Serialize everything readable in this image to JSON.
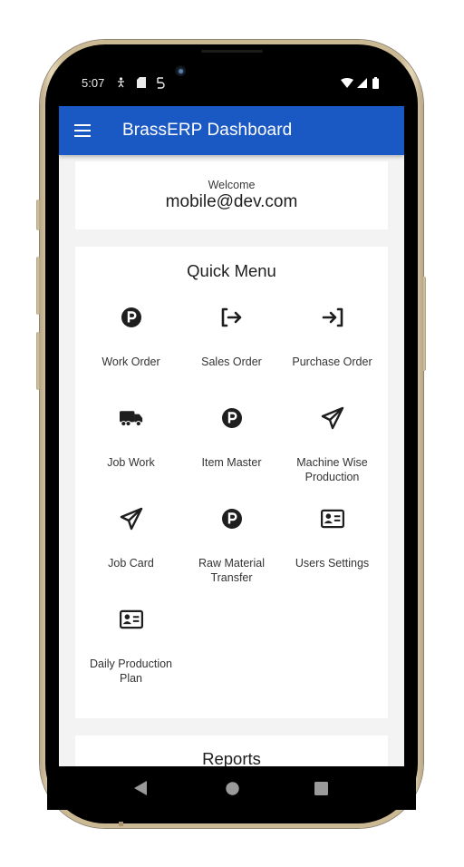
{
  "status_bar": {
    "time": "5:07",
    "left_icons": [
      "accessibility-icon",
      "sd-card-icon",
      "sync-icon"
    ],
    "right_icons": [
      "wifi-icon",
      "signal-icon",
      "battery-icon"
    ]
  },
  "app_bar": {
    "menu_icon": "hamburger-menu-icon",
    "title": "BrassERP Dashboard",
    "background_color": "#1a58c4"
  },
  "welcome": {
    "label": "Welcome",
    "email": "mobile@dev.com"
  },
  "quick_menu": {
    "title": "Quick Menu",
    "items": [
      {
        "label": "Work Order",
        "icon": "parking-circle-icon"
      },
      {
        "label": "Sales Order",
        "icon": "logout-arrow-icon"
      },
      {
        "label": "Purchase Order",
        "icon": "login-arrow-icon"
      },
      {
        "label": "Job Work",
        "icon": "truck-icon"
      },
      {
        "label": "Item Master",
        "icon": "parking-circle-icon"
      },
      {
        "label": "Machine Wise Production",
        "icon": "paper-plane-icon"
      },
      {
        "label": "Job Card",
        "icon": "paper-plane-icon"
      },
      {
        "label": "Raw Material Transfer",
        "icon": "parking-circle-icon"
      },
      {
        "label": "Users Settings",
        "icon": "id-card-icon"
      },
      {
        "label": "Daily Production Plan",
        "icon": "id-card-icon"
      }
    ]
  },
  "reports": {
    "title": "Reports"
  },
  "nav_bar": {
    "buttons": [
      "back-icon",
      "home-icon",
      "recents-icon"
    ]
  }
}
